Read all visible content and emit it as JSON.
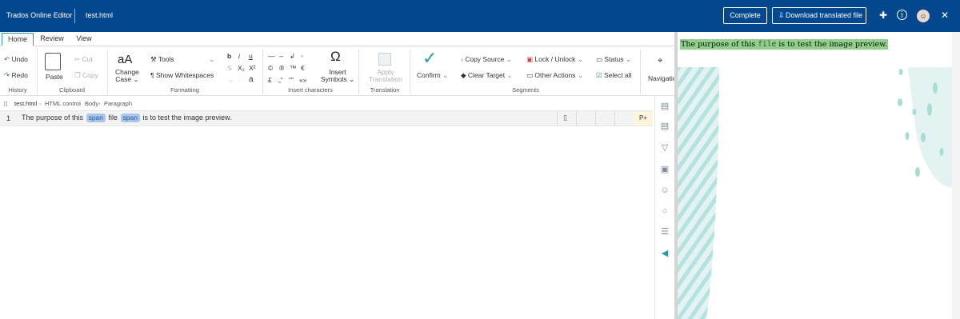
{
  "app": {
    "title": "Trados Online Editor",
    "file": "test.html",
    "complete": "Complete",
    "download": "Download translated file",
    "close": "✕"
  },
  "tabs": [
    "Home",
    "Review",
    "View"
  ],
  "history": {
    "undo": "Undo",
    "redo": "Redo",
    "label": "History"
  },
  "clipboard": {
    "paste": "Paste",
    "cut": "Cut",
    "copy": "Copy",
    "label": "Clipboard"
  },
  "formatting": {
    "change_case_1": "Change",
    "change_case_2": "Case",
    "tools": "Tools",
    "show_ws": "Show Whitespaces",
    "label": "Formatting"
  },
  "insert": {
    "symbols_1": "Insert",
    "symbols_2": "Symbols",
    "label": "Insert characters"
  },
  "translation": {
    "apply_1": "Apply",
    "apply_2": "Translation",
    "label": "Translation"
  },
  "segments": {
    "confirm": "Confirm",
    "copy_source": "Copy Source",
    "clear_target": "Clear Target",
    "lock_unlock": "Lock / Unlock",
    "other_actions": "Other Actions",
    "status": "Status",
    "select_all": "Select all",
    "label": "Segments"
  },
  "navigation": {
    "label": "Navigation"
  },
  "breadcrumb": [
    "test.html",
    "HTML control",
    "Body",
    "Paragraph"
  ],
  "segment": {
    "number": "1",
    "text_before": "The purpose of this",
    "tag1": "span",
    "text_mid": "file",
    "tag2": "span",
    "text_after": "is to test the image preview.",
    "p_plus": "P+"
  },
  "preview": {
    "before": "The purpose of this",
    "code": "file",
    "after": "is to test the image preview."
  },
  "colors": {
    "header": "#03488e",
    "accent": "#2b9aa8",
    "highlight": "#8fd08b",
    "tag": "#a9c6ec"
  }
}
